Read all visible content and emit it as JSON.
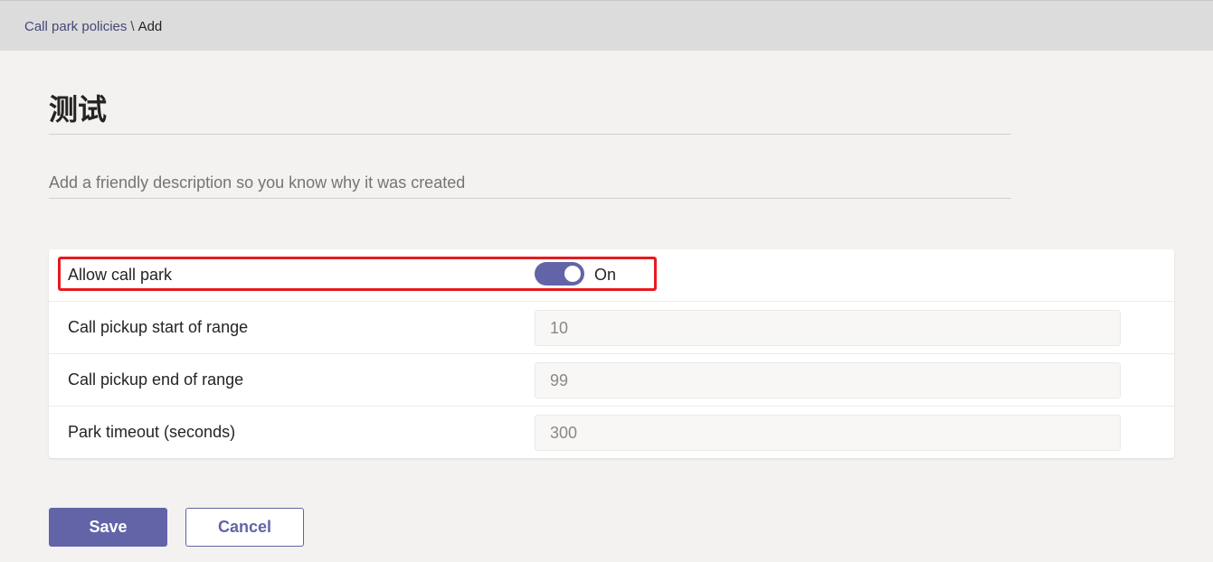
{
  "breadcrumb": {
    "parent": "Call park policies",
    "separator": "\\",
    "current": "Add"
  },
  "page": {
    "title": "测试",
    "description_placeholder": "Add a friendly description so you know why it was created"
  },
  "settings": {
    "allow_call_park": {
      "label": "Allow call park",
      "state": "On",
      "enabled": true
    },
    "rows": [
      {
        "label": "Call pickup start of range",
        "value": "10"
      },
      {
        "label": "Call pickup end of range",
        "value": "99"
      },
      {
        "label": "Park timeout (seconds)",
        "value": "300"
      }
    ]
  },
  "actions": {
    "save_label": "Save",
    "cancel_label": "Cancel"
  },
  "colors": {
    "accent": "#6264a7",
    "highlight": "#e8191d",
    "background": "#f3f2f1",
    "topbar": "#dcdcdc"
  }
}
